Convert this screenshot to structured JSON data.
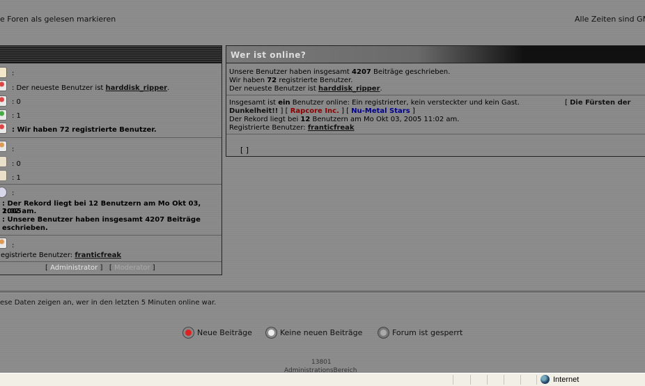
{
  "header": {
    "mark_read": "e Foren als gelesen markieren",
    "timezone": "Alle Zeiten sind GM"
  },
  "left": {
    "r1": ":",
    "r2_prefix": ": Der neueste Benutzer ist ",
    "r2_user": "harddisk_ripper",
    "r2_suffix": ".",
    "r3": ": 0",
    "r4": ": 1",
    "r5": ": Wir haben 72 registrierte Benutzer.",
    "r6": ":",
    "r7": ": 0",
    "r8": ": 1",
    "r9": ":",
    "r10": ": Der Rekord liegt bei 12 Benutzern am Mo Okt 03, 2005",
    "r11": "1:02 am.",
    "r12": ": Unsere Benutzer haben insgesamt 4207 Beiträge",
    "r13": "eschrieben.",
    "r14": ":",
    "r15_prefix": "egistrierte Benutzer: ",
    "r15_user": "franticfreak",
    "role_admin": "Administrator",
    "role_mod": "Moderator"
  },
  "right": {
    "title": "Wer ist online?",
    "p1_a": "Unsere Benutzer haben insgesamt ",
    "p1_b": "4207",
    "p1_c": " Beiträge geschrieben.",
    "p2_a": "Wir haben ",
    "p2_b": "72",
    "p2_c": " registrierte Benutzer.",
    "p3_a": "Der neueste Benutzer ist ",
    "p3_user": "harddisk_ripper",
    "p3_c": ".",
    "s1_a": "Insgesamt ist ",
    "s1_b": "ein",
    "s1_c": " Benutzer online: Ein registrierter, kein versteckter und kein Gast.",
    "s1_d": "[ ",
    "s1_e": "Die Fürsten der",
    "s2_a": "Dunkelheit!!",
    "s2_b": " ]  [ ",
    "s2_c": "Rapcore Inc.",
    "s2_d": " ]  [ ",
    "s2_e": "Nu-Metal Stars",
    "s2_f": " ]",
    "s3_a": "Der Rekord liegt bei ",
    "s3_b": "12",
    "s3_c": " Benutzern am Mo Okt 03, 2005 11:02 am.",
    "s4_a": "Registrierte Benutzer: ",
    "s4_user": "franticfreak",
    "brackets": "[ ]"
  },
  "footer": {
    "note": "ese Daten zeigen an, wer in den letzten 5 Minuten online war.",
    "legend_new": "Neue Beiträge",
    "legend_none": "Keine neuen Beiträge",
    "legend_locked": "Forum ist gesperrt",
    "count": "13801",
    "admin": "AdministrationsBereich"
  },
  "statusbar": {
    "zone": "Internet"
  },
  "colors": {
    "group1": "#111111",
    "group2": "#8b0000",
    "group3": "#00008b"
  }
}
